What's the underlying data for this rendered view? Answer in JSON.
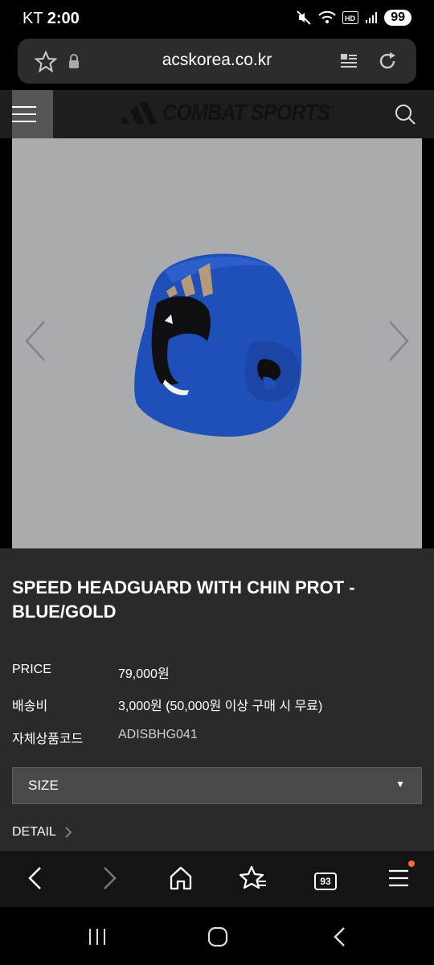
{
  "status_bar": {
    "carrier": "KT",
    "time": "2:00",
    "battery": "99"
  },
  "address_bar": {
    "url": "acskorea.co.kr"
  },
  "site_header": {
    "brand": "COMBAT SPORTS"
  },
  "product": {
    "title": "SPEED HEADGUARD WITH CHIN PROT - BLUE/GOLD",
    "info": [
      {
        "label": "PRICE",
        "value": "79,000원"
      },
      {
        "label": "배송비",
        "value": "3,000원 (50,000원 이상 구매 시 무료)"
      },
      {
        "label": "자체상품코드",
        "value": "ADISBHG041"
      }
    ],
    "size_select": {
      "selected": "SIZE"
    },
    "detail_link": "DETAIL"
  },
  "browser_toolbar": {
    "tabs_count": "93"
  },
  "colors": {
    "background": "#000000",
    "content_bg": "#2a2a2a",
    "gallery_bg": "#a9acaf",
    "product_blue": "#1f4fb8",
    "notification": "#ff6b2c"
  },
  "icons": [
    "star-icon",
    "lock-icon",
    "reader-mode-icon",
    "refresh-icon",
    "hamburger-menu-icon",
    "search-icon",
    "chevron-left-icon",
    "chevron-right-icon",
    "back-icon",
    "forward-icon",
    "home-icon",
    "bookmarks-icon",
    "tabs-icon",
    "browser-menu-icon",
    "recent-apps-icon",
    "home-button-icon",
    "system-back-icon"
  ]
}
